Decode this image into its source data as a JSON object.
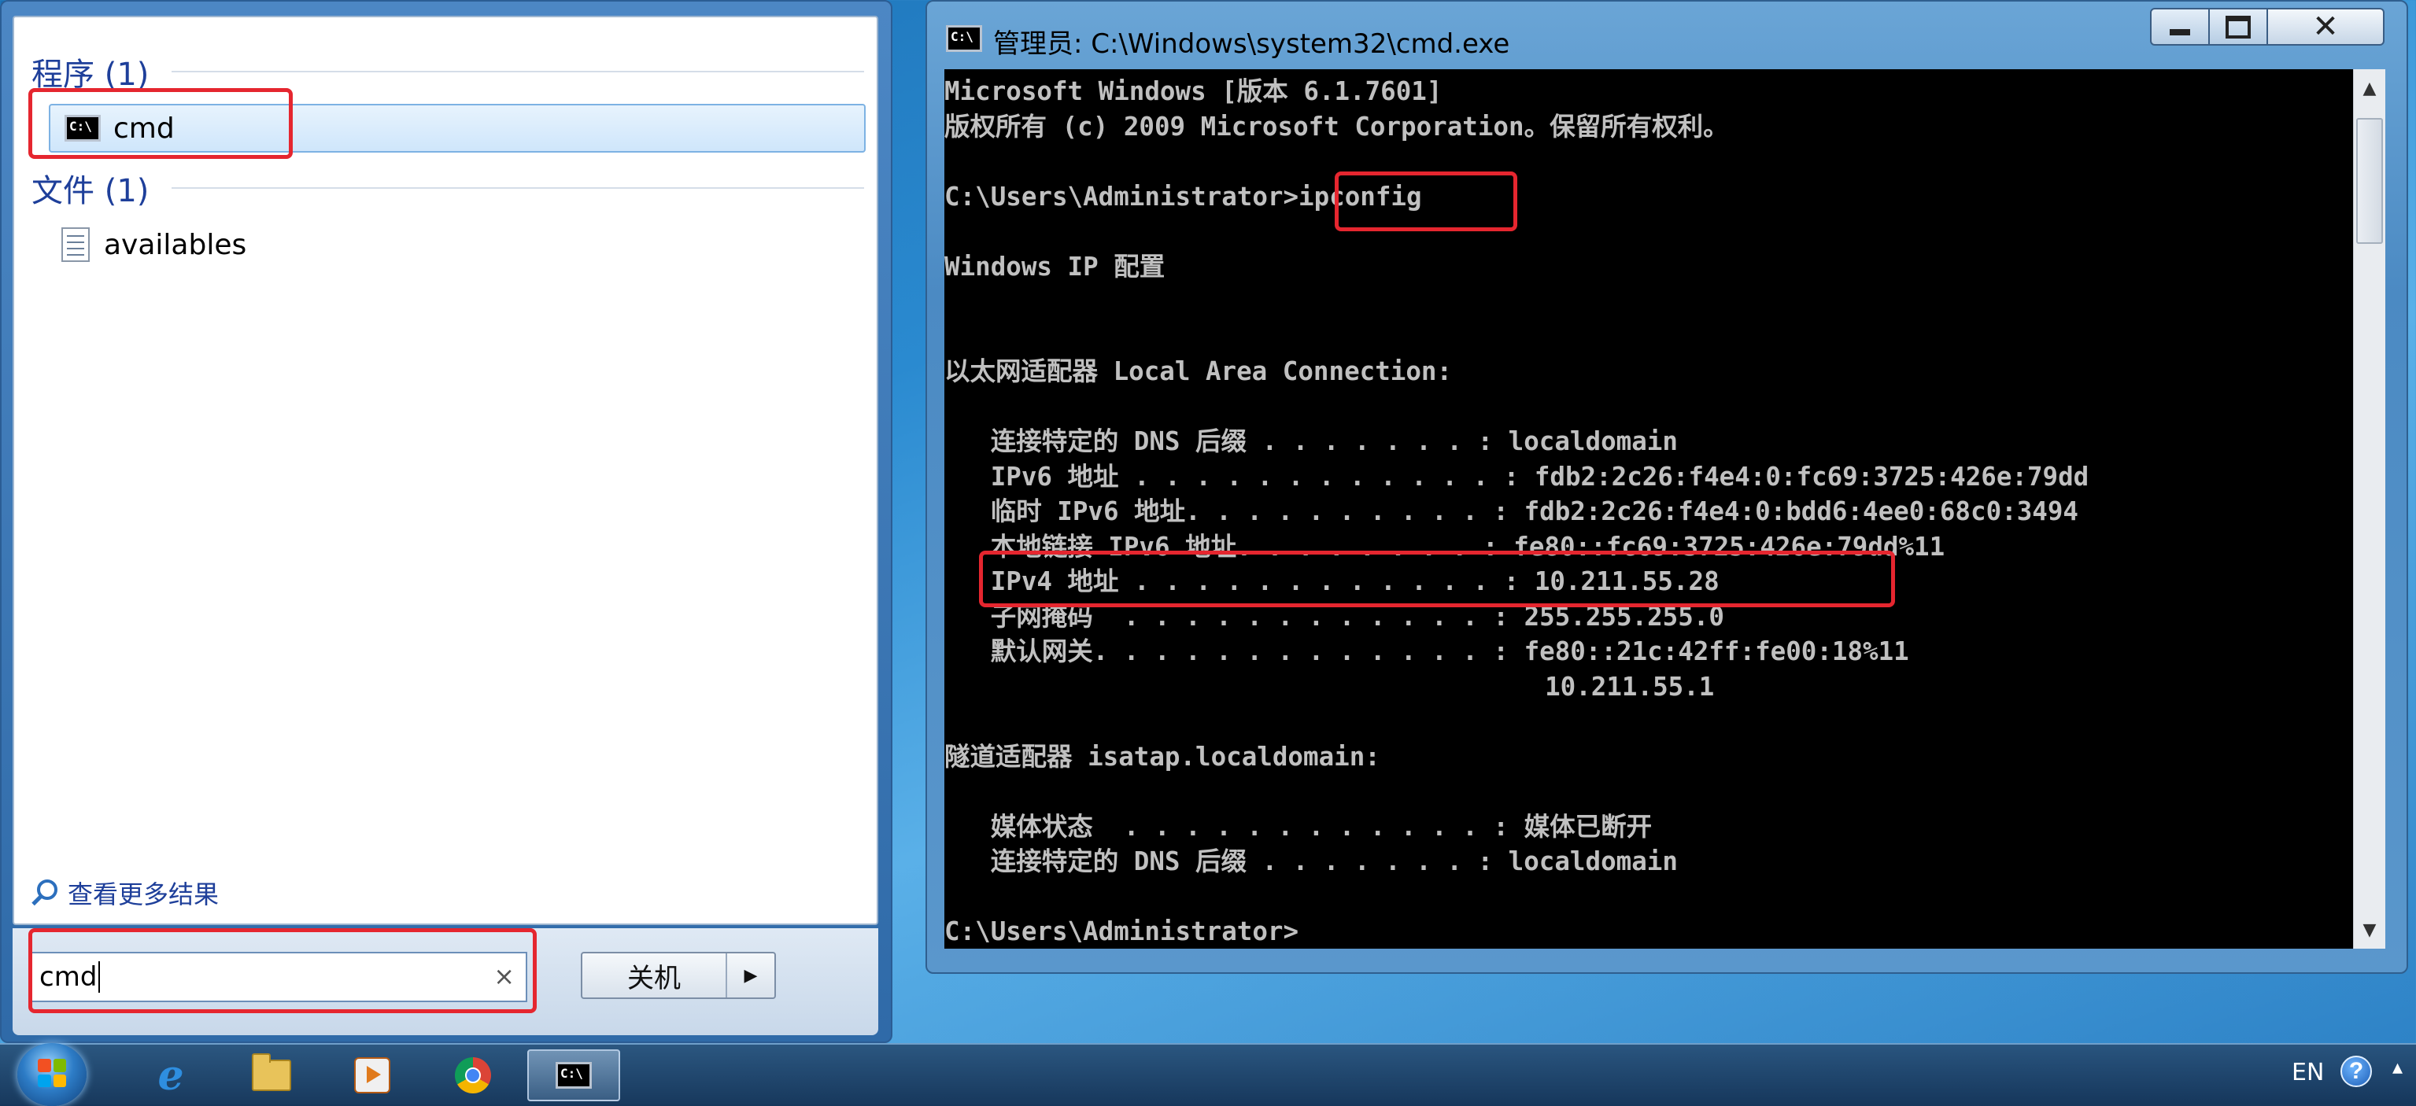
{
  "start_menu": {
    "groups": [
      {
        "header": "程序 (1)",
        "items": [
          {
            "label": "cmd",
            "icon": "cmd-icon",
            "selected": true
          }
        ]
      },
      {
        "header": "文件 (1)",
        "items": [
          {
            "label": "availables",
            "icon": "document-icon",
            "selected": false
          }
        ]
      }
    ],
    "see_more": "查看更多结果",
    "search": {
      "value": "cmd",
      "clear": "×"
    },
    "shutdown": {
      "label": "关机",
      "arrow": "▶"
    }
  },
  "cmd_window": {
    "title": "管理员: C:\\Windows\\system32\\cmd.exe",
    "controls": {
      "minimize": "minimize-icon",
      "maximize": "maximize-icon",
      "close": "✕"
    },
    "lines": [
      "Microsoft Windows [版本 6.1.7601]",
      "版权所有 (c) 2009 Microsoft Corporation。保留所有权利。",
      "",
      "C:\\Users\\Administrator>ipconfig",
      "",
      "Windows IP 配置",
      "",
      "",
      "以太网适配器 Local Area Connection:",
      "",
      "   连接特定的 DNS 后缀 . . . . . . . : localdomain",
      "   IPv6 地址 . . . . . . . . . . . . : fdb2:2c26:f4e4:0:fc69:3725:426e:79dd",
      "   临时 IPv6 地址. . . . . . . . . . : fdb2:2c26:f4e4:0:bdd6:4ee0:68c0:3494",
      "   本地链接 IPv6 地址. . . . . . . . : fe80::fc69:3725:426e:79dd%11",
      "   IPv4 地址 . . . . . . . . . . . . : 10.211.55.28",
      "   子网掩码  . . . . . . . . . . . . : 255.255.255.0",
      "   默认网关. . . . . . . . . . . . . : fe80::21c:42ff:fe00:18%11",
      "                                       10.211.55.1",
      "",
      "隧道适配器 isatap.localdomain:",
      "",
      "   媒体状态  . . . . . . . . . . . . : 媒体已断开",
      "   连接特定的 DNS 后缀 . . . . . . . : localdomain",
      "",
      "C:\\Users\\Administrator>"
    ]
  },
  "taskbar": {
    "items": [
      {
        "name": "internet-explorer-icon",
        "active": false
      },
      {
        "name": "folder-icon",
        "active": false
      },
      {
        "name": "media-player-icon",
        "active": false
      },
      {
        "name": "chrome-icon",
        "active": false
      },
      {
        "name": "cmd-icon",
        "active": true
      }
    ],
    "language": "EN",
    "help": "?"
  },
  "colors": {
    "highlight": "#e5262f",
    "console_text": "#c0c0c0",
    "console_bg": "#000000",
    "menu_header": "#1e3f9a"
  }
}
